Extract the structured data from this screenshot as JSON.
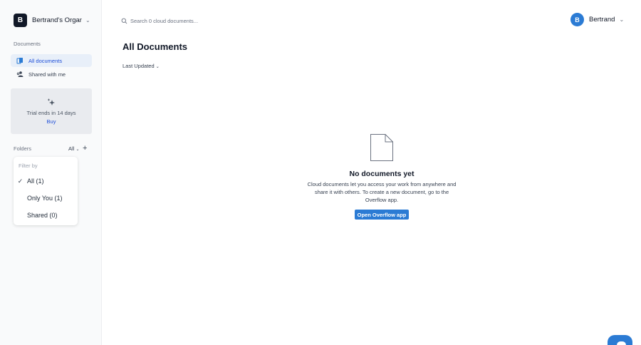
{
  "org": {
    "initial": "B",
    "name": "Bertrand's Organization"
  },
  "sidebar": {
    "section_label": "Documents",
    "items": [
      {
        "label": "All documents",
        "icon": "documents-icon",
        "active": true
      },
      {
        "label": "Shared with me",
        "icon": "shared-users-icon",
        "active": false
      }
    ],
    "trial": {
      "text": "Trial ends in 14 days",
      "buy": "Buy"
    },
    "folders": {
      "label": "Folders",
      "filter_value": "All",
      "add_label": "+",
      "dropdown": {
        "header": "Filter by",
        "options": [
          {
            "label": "All (1)",
            "checked": true
          },
          {
            "label": "Only You (1)",
            "checked": false
          },
          {
            "label": "Shared (0)",
            "checked": false
          }
        ]
      }
    }
  },
  "search": {
    "placeholder": "Search 0 cloud documents..."
  },
  "user": {
    "initial": "B",
    "name": "Bertrand"
  },
  "main": {
    "title": "All Documents",
    "sort_label": "Last Updated",
    "empty": {
      "title": "No documents yet",
      "body": "Cloud documents let you access your work from anywhere and share it with others. To create a new document, go to the Overflow app.",
      "button": "Open Overflow app"
    }
  },
  "colors": {
    "accent": "#2b7bd4",
    "active_bg": "#e8eff9",
    "sidebar_bg": "#f9fafb",
    "trial_bg": "#e9ebef"
  }
}
